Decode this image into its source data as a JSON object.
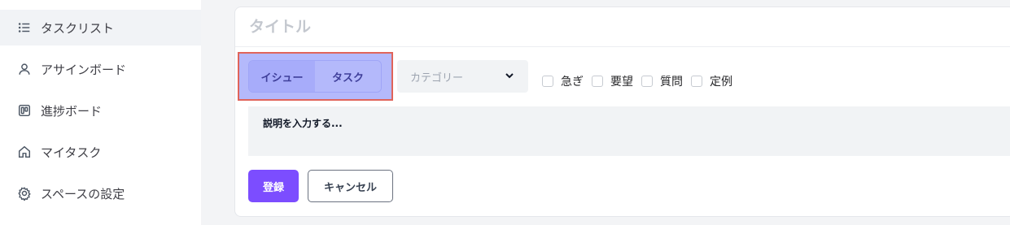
{
  "sidebar": {
    "items": [
      {
        "label": "タスクリスト",
        "icon": "list-icon",
        "active": true
      },
      {
        "label": "アサインボード",
        "icon": "user-icon",
        "active": false
      },
      {
        "label": "進捗ボード",
        "icon": "board-icon",
        "active": false
      },
      {
        "label": "マイタスク",
        "icon": "home-icon",
        "active": false
      },
      {
        "label": "スペースの設定",
        "icon": "gear-icon",
        "active": false
      }
    ]
  },
  "form": {
    "title_placeholder": "タイトル",
    "type_toggle": {
      "options": [
        "イシュー",
        "タスク"
      ],
      "selected": "イシュー"
    },
    "category": {
      "placeholder": "カテゴリー",
      "icon": "chevron-down-icon"
    },
    "tags": [
      {
        "label": "急ぎ",
        "checked": false
      },
      {
        "label": "要望",
        "checked": false
      },
      {
        "label": "質問",
        "checked": false
      },
      {
        "label": "定例",
        "checked": false
      }
    ],
    "description_placeholder": "説明を入力する...",
    "submit_label": "登録",
    "cancel_label": "キャンセル"
  },
  "colors": {
    "accent": "#7c4dff",
    "toggle_bg": "#b4b9fb",
    "toggle_selected": "#a7acfa",
    "highlight_border": "#e0645a"
  }
}
